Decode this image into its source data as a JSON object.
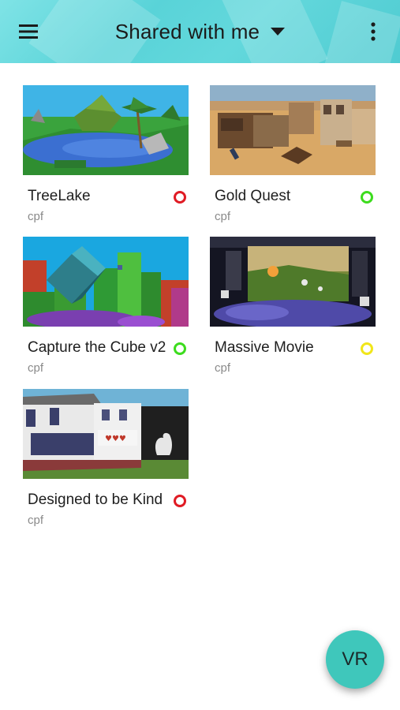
{
  "header": {
    "title": "Shared with me",
    "menu_icon": "hamburger-menu-icon",
    "dropdown_icon": "caret-down-icon",
    "more_icon": "more-vertical-icon",
    "accent_color": "#5ad4d9"
  },
  "cards": [
    {
      "title": "TreeLake",
      "subtitle": "cpf",
      "status_color": "#e01b24",
      "thumbnail": "tropical-lake-scene"
    },
    {
      "title": "Gold Quest",
      "subtitle": "cpf",
      "status_color": "#3ddc1e",
      "thumbnail": "western-town-scene"
    },
    {
      "title": "Capture the Cube v2",
      "subtitle": "cpf",
      "status_color": "#3ddc1e",
      "thumbnail": "blocky-cube-scene"
    },
    {
      "title": "Massive Movie",
      "subtitle": "cpf",
      "status_color": "#f1e61a",
      "thumbnail": "cinema-screen-scene"
    },
    {
      "title": "Designed to be Kind",
      "subtitle": "cpf",
      "status_color": "#e01b24",
      "thumbnail": "storefront-scene"
    }
  ],
  "fab": {
    "label": "VR",
    "color": "#3fc7bb"
  }
}
